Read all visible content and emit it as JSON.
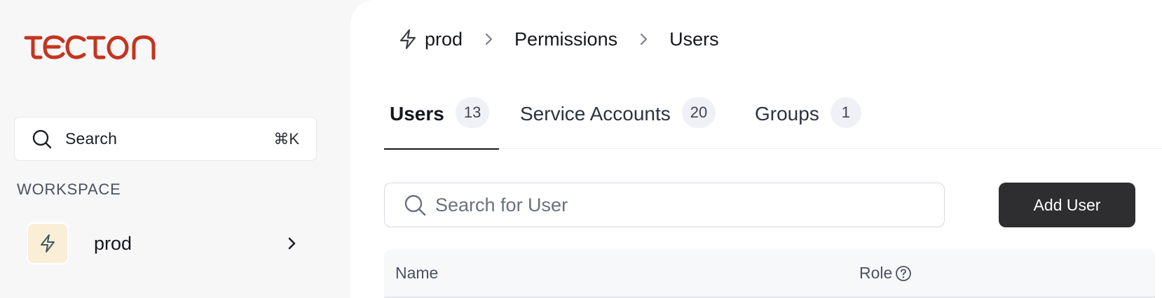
{
  "sidebar": {
    "logo_text": "tecton",
    "brand_color": "#c4351f",
    "search": {
      "label": "Search",
      "shortcut": "⌘K",
      "icon": "search-icon"
    },
    "workspace_heading": "WORKSPACE",
    "workspace": {
      "name": "prod",
      "icon": "bolt-icon",
      "chevron": "chevron-right-icon"
    }
  },
  "breadcrumb": {
    "items": [
      {
        "label": "prod",
        "icon": "bolt-icon"
      },
      {
        "label": "Permissions"
      },
      {
        "label": "Users"
      }
    ]
  },
  "tabs": [
    {
      "label": "Users",
      "count": "13",
      "active": true
    },
    {
      "label": "Service Accounts",
      "count": "20",
      "active": false
    },
    {
      "label": "Groups",
      "count": "1",
      "active": false
    }
  ],
  "user_search": {
    "placeholder": "Search for User",
    "value": ""
  },
  "actions": {
    "add_user_label": "Add User"
  },
  "table": {
    "columns": [
      {
        "label": "Name"
      },
      {
        "label": "Role",
        "help_icon": "question-circle-icon"
      }
    ]
  }
}
